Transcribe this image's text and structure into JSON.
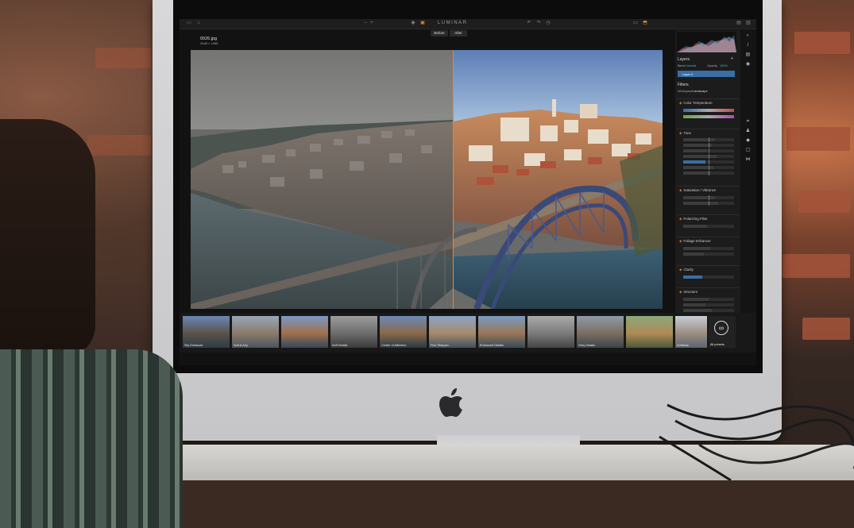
{
  "app": {
    "title": "LUMINAR",
    "file_name": "0026.jpg",
    "file_dims": "2448 × 1465"
  },
  "compare": {
    "before_label": "Before",
    "after_label": "After"
  },
  "panel": {
    "layers_title": "Layers",
    "blend_label": "Blend",
    "blend_value": "Normal",
    "opacity_label": "Opacity",
    "opacity_value": "100%",
    "layer_name": "Layer 0",
    "filters_title": "Filters",
    "workspace_label": "Workspace",
    "workspace_value": "Landscape",
    "sections": [
      {
        "title": "Color Temperature"
      },
      {
        "title": "Tone"
      },
      {
        "title": "Saturation / Vibrance"
      },
      {
        "title": "Polarizing Filter"
      },
      {
        "title": "Foliage Enhancer"
      },
      {
        "title": "Clarity"
      },
      {
        "title": "Structure"
      }
    ]
  },
  "filmstrip": {
    "presets": [
      {
        "label": "Sky Enhancer"
      },
      {
        "label": "Soft & Airy"
      },
      {
        "label": ""
      },
      {
        "label": "Soft Details"
      },
      {
        "label": "Center of Attention"
      },
      {
        "label": "Fine Sharpen"
      },
      {
        "label": "Enhanced Details"
      },
      {
        "label": ""
      },
      {
        "label": "Grey Details"
      },
      {
        "label": ""
      },
      {
        "label": "Enhanced Details"
      },
      {
        "label": "Softness"
      }
    ],
    "all_presets_label": "All presets",
    "all_presets_icon": "infinity-icon"
  },
  "colors": {
    "accent": "#e0893a",
    "panel_bg": "#1c1c1c",
    "highlight": "#3a6ea5"
  }
}
